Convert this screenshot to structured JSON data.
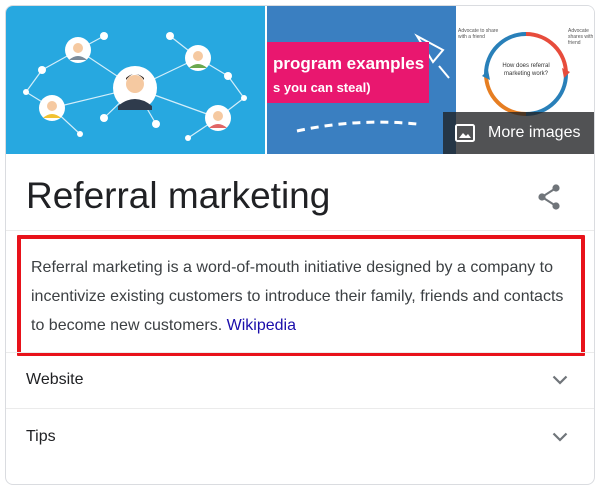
{
  "images": {
    "image2": {
      "line1": "program examples",
      "line2": "s you can steal)"
    },
    "image3": {
      "center_text": "How does referral marketing work?",
      "top_left": "Advocate to share with a friend",
      "top_right": "Advocate shares with a friend"
    },
    "more_images_label": "More images"
  },
  "panel": {
    "title": "Referral marketing",
    "description": "Referral marketing is a word-of-mouth initiative designed by a company to incentivize existing customers to introduce their family, friends and contacts to become new customers.",
    "source_link": "Wikipedia"
  },
  "rows": [
    {
      "label": "Website"
    },
    {
      "label": "Tips"
    }
  ],
  "colors": {
    "highlight_border": "#e8121a",
    "link": "#1a0dab",
    "image1_bg": "#27a8e0",
    "image2_banner": "#e9176f"
  },
  "icons": {
    "share": "share-icon",
    "more_images": "image-icon",
    "expand": "chevron-down-icon"
  }
}
